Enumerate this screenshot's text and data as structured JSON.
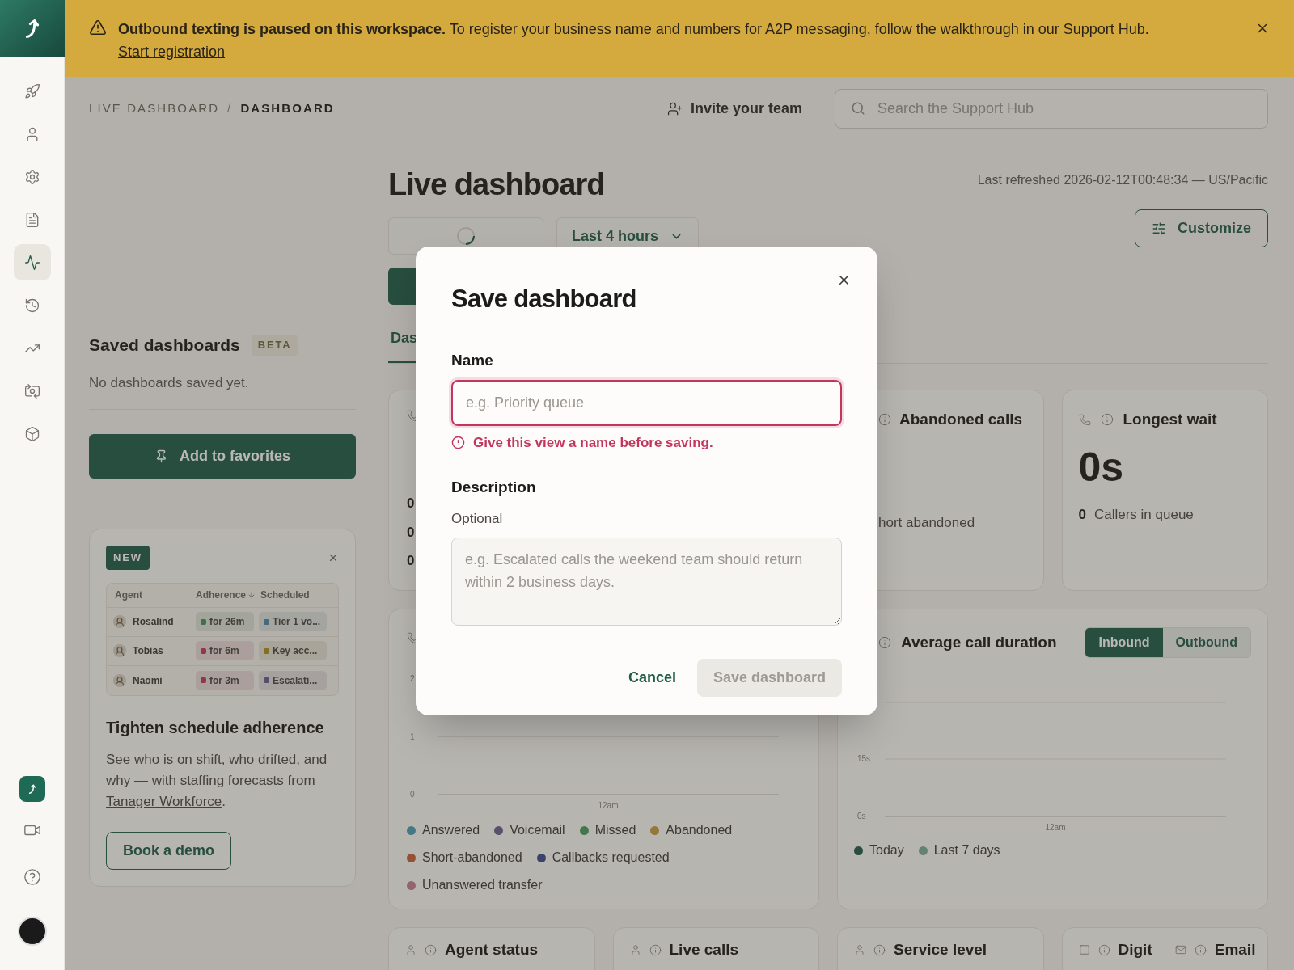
{
  "sidebar": {
    "items": [
      {
        "selected": false
      },
      {
        "selected": false
      },
      {
        "selected": false
      },
      {
        "selected": false
      },
      {
        "selected": true
      },
      {
        "selected": false
      },
      {
        "selected": false
      },
      {
        "selected": false
      },
      {
        "selected": false
      }
    ]
  },
  "banner": {
    "text": "**Outbound texting is paused on this workspace.** To register your business name and numbers for A2P messaging, follow the walkthrough in our Support Hub.",
    "link": "Start registration"
  },
  "header": {
    "breadcrumbs": [
      "LIVE DASHBOARD",
      "DASHBOARD"
    ],
    "separator": "/",
    "invite": "Invite your team",
    "search_placeholder": "Search the Support Hub"
  },
  "saved": {
    "title": "Saved dashboards",
    "badge": "BETA",
    "empty": "No dashboards saved yet.",
    "favorite_button": "Add to favorites"
  },
  "promo": {
    "badge": "NEW",
    "columns": [
      "Agent",
      "Adherence",
      "Scheduled"
    ],
    "rows": [
      {
        "agent": "Rosalind",
        "adherence": {
          "text": "for 26m",
          "color": "#3d704b"
        },
        "scheduled": {
          "text": "Tier 1 vo...",
          "color": "#446b7b"
        }
      },
      {
        "agent": "Tobias",
        "adherence": {
          "text": "for 6m",
          "color": "#92364b"
        },
        "scheduled": {
          "text": "Key acc...",
          "color": "#827123"
        }
      },
      {
        "agent": "Naomi",
        "adherence": {
          "text": "for 3m",
          "color": "#92364b"
        },
        "scheduled": {
          "text": "Escalati...",
          "color": "#574d6e"
        }
      }
    ],
    "title": "Tighten schedule adherence",
    "body": "See who is on shift, who drifted, and why — with staffing forecasts from",
    "link": "Tanager Workforce",
    "after_link": ".",
    "button": "Book a demo"
  },
  "main": {
    "title": "Live dashboard",
    "refreshed": "Last refreshed 2026-02-12T00:48:34 — US/Pacific",
    "range": "Last 4 hours",
    "customize": "Customize",
    "tabs": [
      {
        "label": "Das",
        "selected": true
      }
    ],
    "stat_cards": [
      {
        "lines": [
          "0",
          "0",
          "0"
        ]
      },
      {
        "title": "Abandoned calls",
        "sub": "hort abandoned"
      },
      {
        "title": "Longest wait",
        "value": "0s",
        "count": "0",
        "sub": "Callers in queue"
      }
    ],
    "calls_chart": {
      "y_labels": [
        "2",
        "1",
        "0"
      ],
      "x_label": "12am",
      "legend": [
        {
          "name": "Answered",
          "color": "#447884"
        },
        {
          "name": "Voicemail",
          "color": "#59506d"
        },
        {
          "name": "Missed",
          "color": "#44784b"
        },
        {
          "name": "Abandoned",
          "color": "#947838"
        },
        {
          "name": "Short-abandoned",
          "color": "#945135"
        },
        {
          "name": "Callbacks requested",
          "color": "#3a436c"
        },
        {
          "name": "Unanswered transfer",
          "color": "#946370"
        }
      ]
    },
    "duration_chart": {
      "title": "Average call duration",
      "toggle": [
        {
          "label": "Inbound",
          "selected": true
        },
        {
          "label": "Outbound",
          "selected": false
        }
      ],
      "y_labels": [
        "15s",
        "0s"
      ],
      "x_label": "12am",
      "legend": [
        {
          "name": "Today",
          "color": "#294e40"
        },
        {
          "name": "Last 7 days",
          "color": "#648274"
        }
      ]
    },
    "bottom_cards": [
      {
        "titles": [
          "Agent status"
        ]
      },
      {
        "titles": [
          "Live calls"
        ]
      },
      {
        "titles": [
          "Service level"
        ]
      },
      {
        "titles": [
          "Digit",
          "Email"
        ]
      }
    ]
  },
  "modal": {
    "title": "Save dashboard",
    "name_label": "Name",
    "name_placeholder": "e.g. Priority queue",
    "name_error": "Give this view a name before saving.",
    "description_label": "Description",
    "description_hint": "Optional",
    "description_placeholder": "e.g. Escalated calls the weekend team should return within 2 business days.",
    "cancel": "Cancel",
    "save": {
      "label": "Save dashboard",
      "disabled": true
    }
  }
}
